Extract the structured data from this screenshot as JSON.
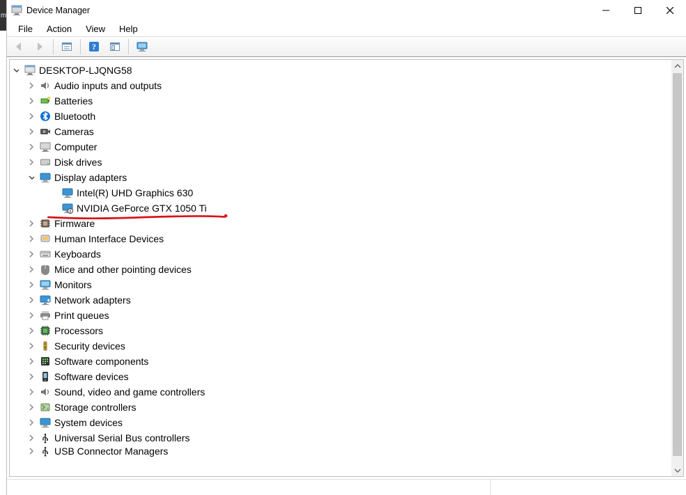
{
  "titlebar": {
    "title": "Device Manager"
  },
  "menu": {
    "items": [
      "File",
      "Action",
      "View",
      "Help"
    ]
  },
  "toolbar": {
    "buttons": [
      {
        "name": "back-icon",
        "kind": "arrow-left",
        "enabled": false
      },
      {
        "name": "forward-icon",
        "kind": "arrow-right",
        "enabled": false
      },
      {
        "sep": true
      },
      {
        "name": "show-hidden-icon",
        "kind": "panel1"
      },
      {
        "sep": true
      },
      {
        "name": "help-icon",
        "kind": "help"
      },
      {
        "name": "scan-icon",
        "kind": "panel2"
      },
      {
        "sep": true
      },
      {
        "name": "monitor-icon",
        "kind": "monitor"
      }
    ]
  },
  "tree": {
    "root": {
      "label": "DESKTOP-LJQNG58",
      "expanded": true,
      "icon": "computer-root"
    },
    "categories": [
      {
        "label": "Audio inputs and outputs",
        "icon": "speaker"
      },
      {
        "label": "Batteries",
        "icon": "battery"
      },
      {
        "label": "Bluetooth",
        "icon": "bluetooth"
      },
      {
        "label": "Cameras",
        "icon": "camera"
      },
      {
        "label": "Computer",
        "icon": "computer"
      },
      {
        "label": "Disk drives",
        "icon": "disk"
      },
      {
        "label": "Display adapters",
        "icon": "display",
        "expanded": true,
        "children": [
          {
            "label": "Intel(R) UHD Graphics 630",
            "icon": "display"
          },
          {
            "label": "NVIDIA GeForce GTX 1050 Ti",
            "icon": "display-warn",
            "underlined": true
          }
        ]
      },
      {
        "label": "Firmware",
        "icon": "chip"
      },
      {
        "label": "Human Interface Devices",
        "icon": "hid"
      },
      {
        "label": "Keyboards",
        "icon": "keyboard"
      },
      {
        "label": "Mice and other pointing devices",
        "icon": "mouse"
      },
      {
        "label": "Monitors",
        "icon": "monitor"
      },
      {
        "label": "Network adapters",
        "icon": "network"
      },
      {
        "label": "Print queues",
        "icon": "printer"
      },
      {
        "label": "Processors",
        "icon": "cpu"
      },
      {
        "label": "Security devices",
        "icon": "security"
      },
      {
        "label": "Software components",
        "icon": "swcomp"
      },
      {
        "label": "Software devices",
        "icon": "swdev"
      },
      {
        "label": "Sound, video and game controllers",
        "icon": "speaker"
      },
      {
        "label": "Storage controllers",
        "icon": "storage"
      },
      {
        "label": "System devices",
        "icon": "system"
      },
      {
        "label": "Universal Serial Bus controllers",
        "icon": "usb"
      },
      {
        "label": "USB Connector Managers",
        "icon": "usb",
        "clipped": true
      }
    ]
  },
  "left_sliver": "m"
}
